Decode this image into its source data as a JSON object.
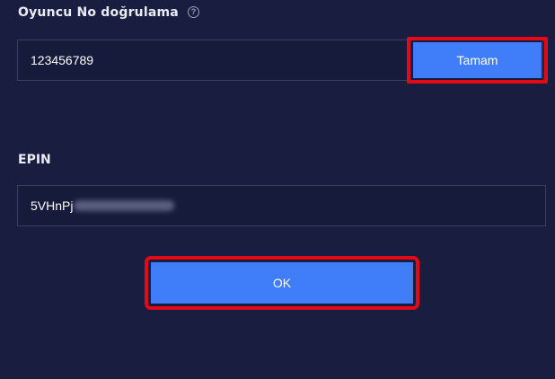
{
  "player_verification": {
    "label": "Oyuncu No doğrulama",
    "help_icon": "question-circle-icon",
    "player_id_value": "123456789",
    "confirm_button_label": "Tamam"
  },
  "epin": {
    "label": "EPIN",
    "value_visible_prefix": "5VHnPj"
  },
  "ok_button_label": "OK",
  "colors": {
    "background": "#191d3f",
    "field_background": "#161b3b",
    "field_border": "#3a3f5e",
    "button": "#3f7ef8",
    "highlight": "#e30a17"
  }
}
